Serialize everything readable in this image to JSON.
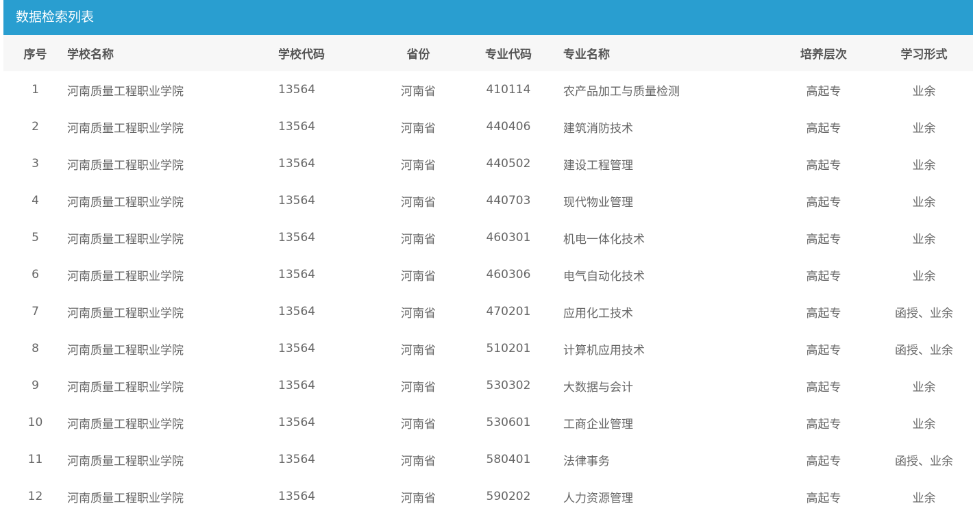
{
  "panel": {
    "title": "数据检索列表"
  },
  "table": {
    "headers": {
      "index": "序号",
      "school_name": "学校名称",
      "school_code": "学校代码",
      "province": "省份",
      "major_code": "专业代码",
      "major_name": "专业名称",
      "level": "培养层次",
      "study_mode": "学习形式"
    },
    "rows": [
      {
        "index": "1",
        "school_name": "河南质量工程职业学院",
        "school_code": "13564",
        "province": "河南省",
        "major_code": "410114",
        "major_name": "农产品加工与质量检测",
        "level": "高起专",
        "study_mode": "业余"
      },
      {
        "index": "2",
        "school_name": "河南质量工程职业学院",
        "school_code": "13564",
        "province": "河南省",
        "major_code": "440406",
        "major_name": "建筑消防技术",
        "level": "高起专",
        "study_mode": "业余"
      },
      {
        "index": "3",
        "school_name": "河南质量工程职业学院",
        "school_code": "13564",
        "province": "河南省",
        "major_code": "440502",
        "major_name": "建设工程管理",
        "level": "高起专",
        "study_mode": "业余"
      },
      {
        "index": "4",
        "school_name": "河南质量工程职业学院",
        "school_code": "13564",
        "province": "河南省",
        "major_code": "440703",
        "major_name": "现代物业管理",
        "level": "高起专",
        "study_mode": "业余"
      },
      {
        "index": "5",
        "school_name": "河南质量工程职业学院",
        "school_code": "13564",
        "province": "河南省",
        "major_code": "460301",
        "major_name": "机电一体化技术",
        "level": "高起专",
        "study_mode": "业余"
      },
      {
        "index": "6",
        "school_name": "河南质量工程职业学院",
        "school_code": "13564",
        "province": "河南省",
        "major_code": "460306",
        "major_name": "电气自动化技术",
        "level": "高起专",
        "study_mode": "业余"
      },
      {
        "index": "7",
        "school_name": "河南质量工程职业学院",
        "school_code": "13564",
        "province": "河南省",
        "major_code": "470201",
        "major_name": "应用化工技术",
        "level": "高起专",
        "study_mode": "函授、业余"
      },
      {
        "index": "8",
        "school_name": "河南质量工程职业学院",
        "school_code": "13564",
        "province": "河南省",
        "major_code": "510201",
        "major_name": "计算机应用技术",
        "level": "高起专",
        "study_mode": "函授、业余"
      },
      {
        "index": "9",
        "school_name": "河南质量工程职业学院",
        "school_code": "13564",
        "province": "河南省",
        "major_code": "530302",
        "major_name": "大数据与会计",
        "level": "高起专",
        "study_mode": "业余"
      },
      {
        "index": "10",
        "school_name": "河南质量工程职业学院",
        "school_code": "13564",
        "province": "河南省",
        "major_code": "530601",
        "major_name": "工商企业管理",
        "level": "高起专",
        "study_mode": "业余"
      },
      {
        "index": "11",
        "school_name": "河南质量工程职业学院",
        "school_code": "13564",
        "province": "河南省",
        "major_code": "580401",
        "major_name": "法律事务",
        "level": "高起专",
        "study_mode": "函授、业余"
      },
      {
        "index": "12",
        "school_name": "河南质量工程职业学院",
        "school_code": "13564",
        "province": "河南省",
        "major_code": "590202",
        "major_name": "人力资源管理",
        "level": "高起专",
        "study_mode": "业余"
      }
    ]
  },
  "colors": {
    "header_bar": "#299ed0",
    "table_head_bg": "#f7f7f7"
  }
}
